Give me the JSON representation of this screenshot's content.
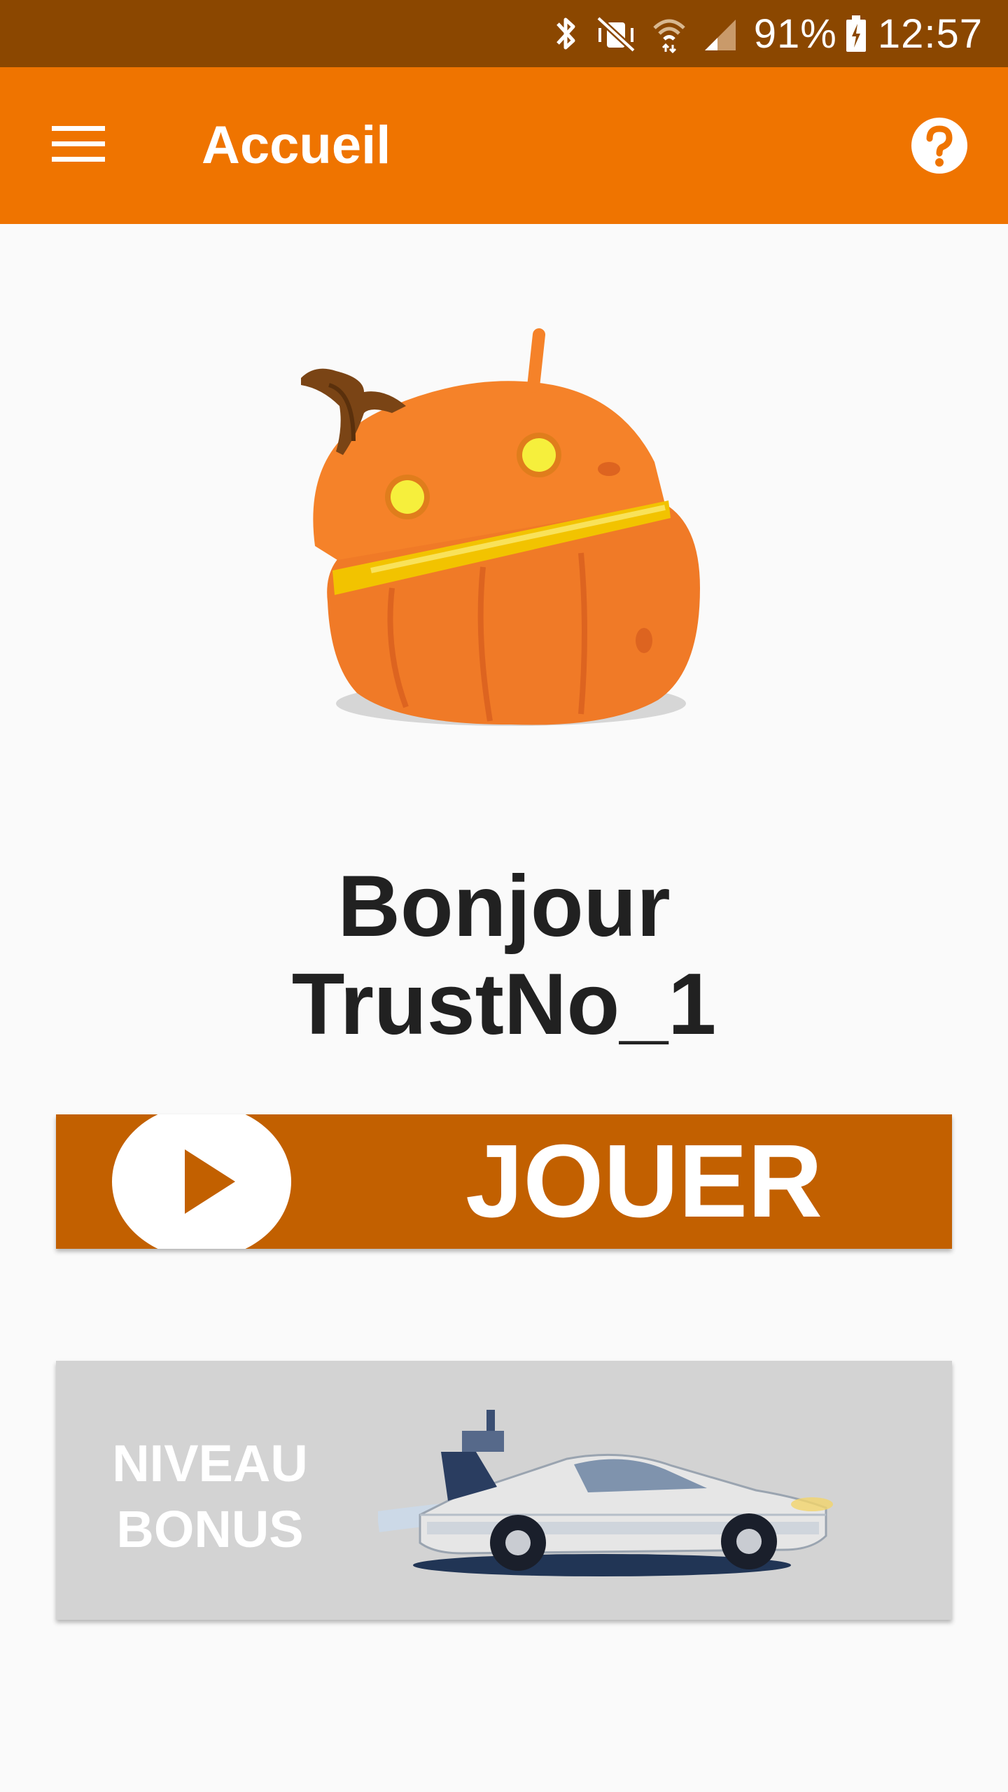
{
  "status_bar": {
    "battery": "91%",
    "time": "12:57",
    "icons": [
      "bluetooth-icon",
      "vibrate-off-icon",
      "wifi-icon",
      "signal-icon",
      "battery-icon"
    ]
  },
  "app_bar": {
    "title": "Accueil",
    "menu_icon": "hamburger-menu-icon",
    "help_icon": "help-icon"
  },
  "main": {
    "mascot": "android-pumpkin-mascot",
    "greeting_line1": "Bonjour",
    "greeting_line2": "TrustNo_1",
    "play_label": "JOUER",
    "bonus_line1": "NIVEAU",
    "bonus_line2": "BONUS",
    "bonus_image": "delorean-car-image"
  },
  "colors": {
    "status_bar": "#8b4700",
    "app_bar": "#ef7400",
    "play_button": "#c26000",
    "bonus_button": "#d3d3d3",
    "background": "#fafafa"
  }
}
